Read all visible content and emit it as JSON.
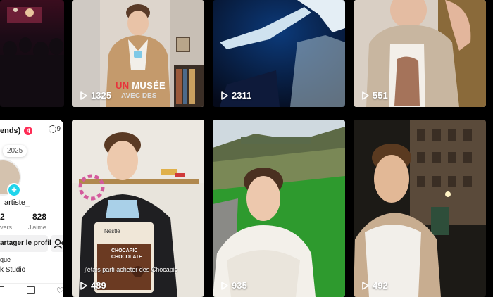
{
  "tiles": [
    {
      "id": "concert",
      "views": ""
    },
    {
      "id": "musee",
      "views": "1325",
      "caption_red": "UN",
      "caption_white": " MUSÉE",
      "caption_sub": "AVEC DES"
    },
    {
      "id": "dance",
      "views": "2311"
    },
    {
      "id": "selfie-wall",
      "views": "551"
    },
    {
      "id": "chocapic",
      "views": "489",
      "caption": "j'étais parti acheter des Chocapic",
      "box_brand": "Nestlé",
      "box_text": "CHOCAPIC CHOCOLATE"
    },
    {
      "id": "park",
      "views": "935"
    },
    {
      "id": "night",
      "views": "492"
    }
  ],
  "profile": {
    "friends_label": "ends)",
    "friends_count": "4",
    "tag": "2025",
    "username": "artiste_",
    "stat1_value": "2",
    "stat1_label": "vers",
    "stat2_value": "828",
    "stat2_label": "J'aime",
    "share_button": "artager le profil",
    "section_label": "que",
    "studio_label": "k Studio",
    "top_right_glyph": "9"
  },
  "colors": {
    "accent_red": "#fe2c55",
    "teal": "#20d5ec",
    "background": "#000000"
  }
}
